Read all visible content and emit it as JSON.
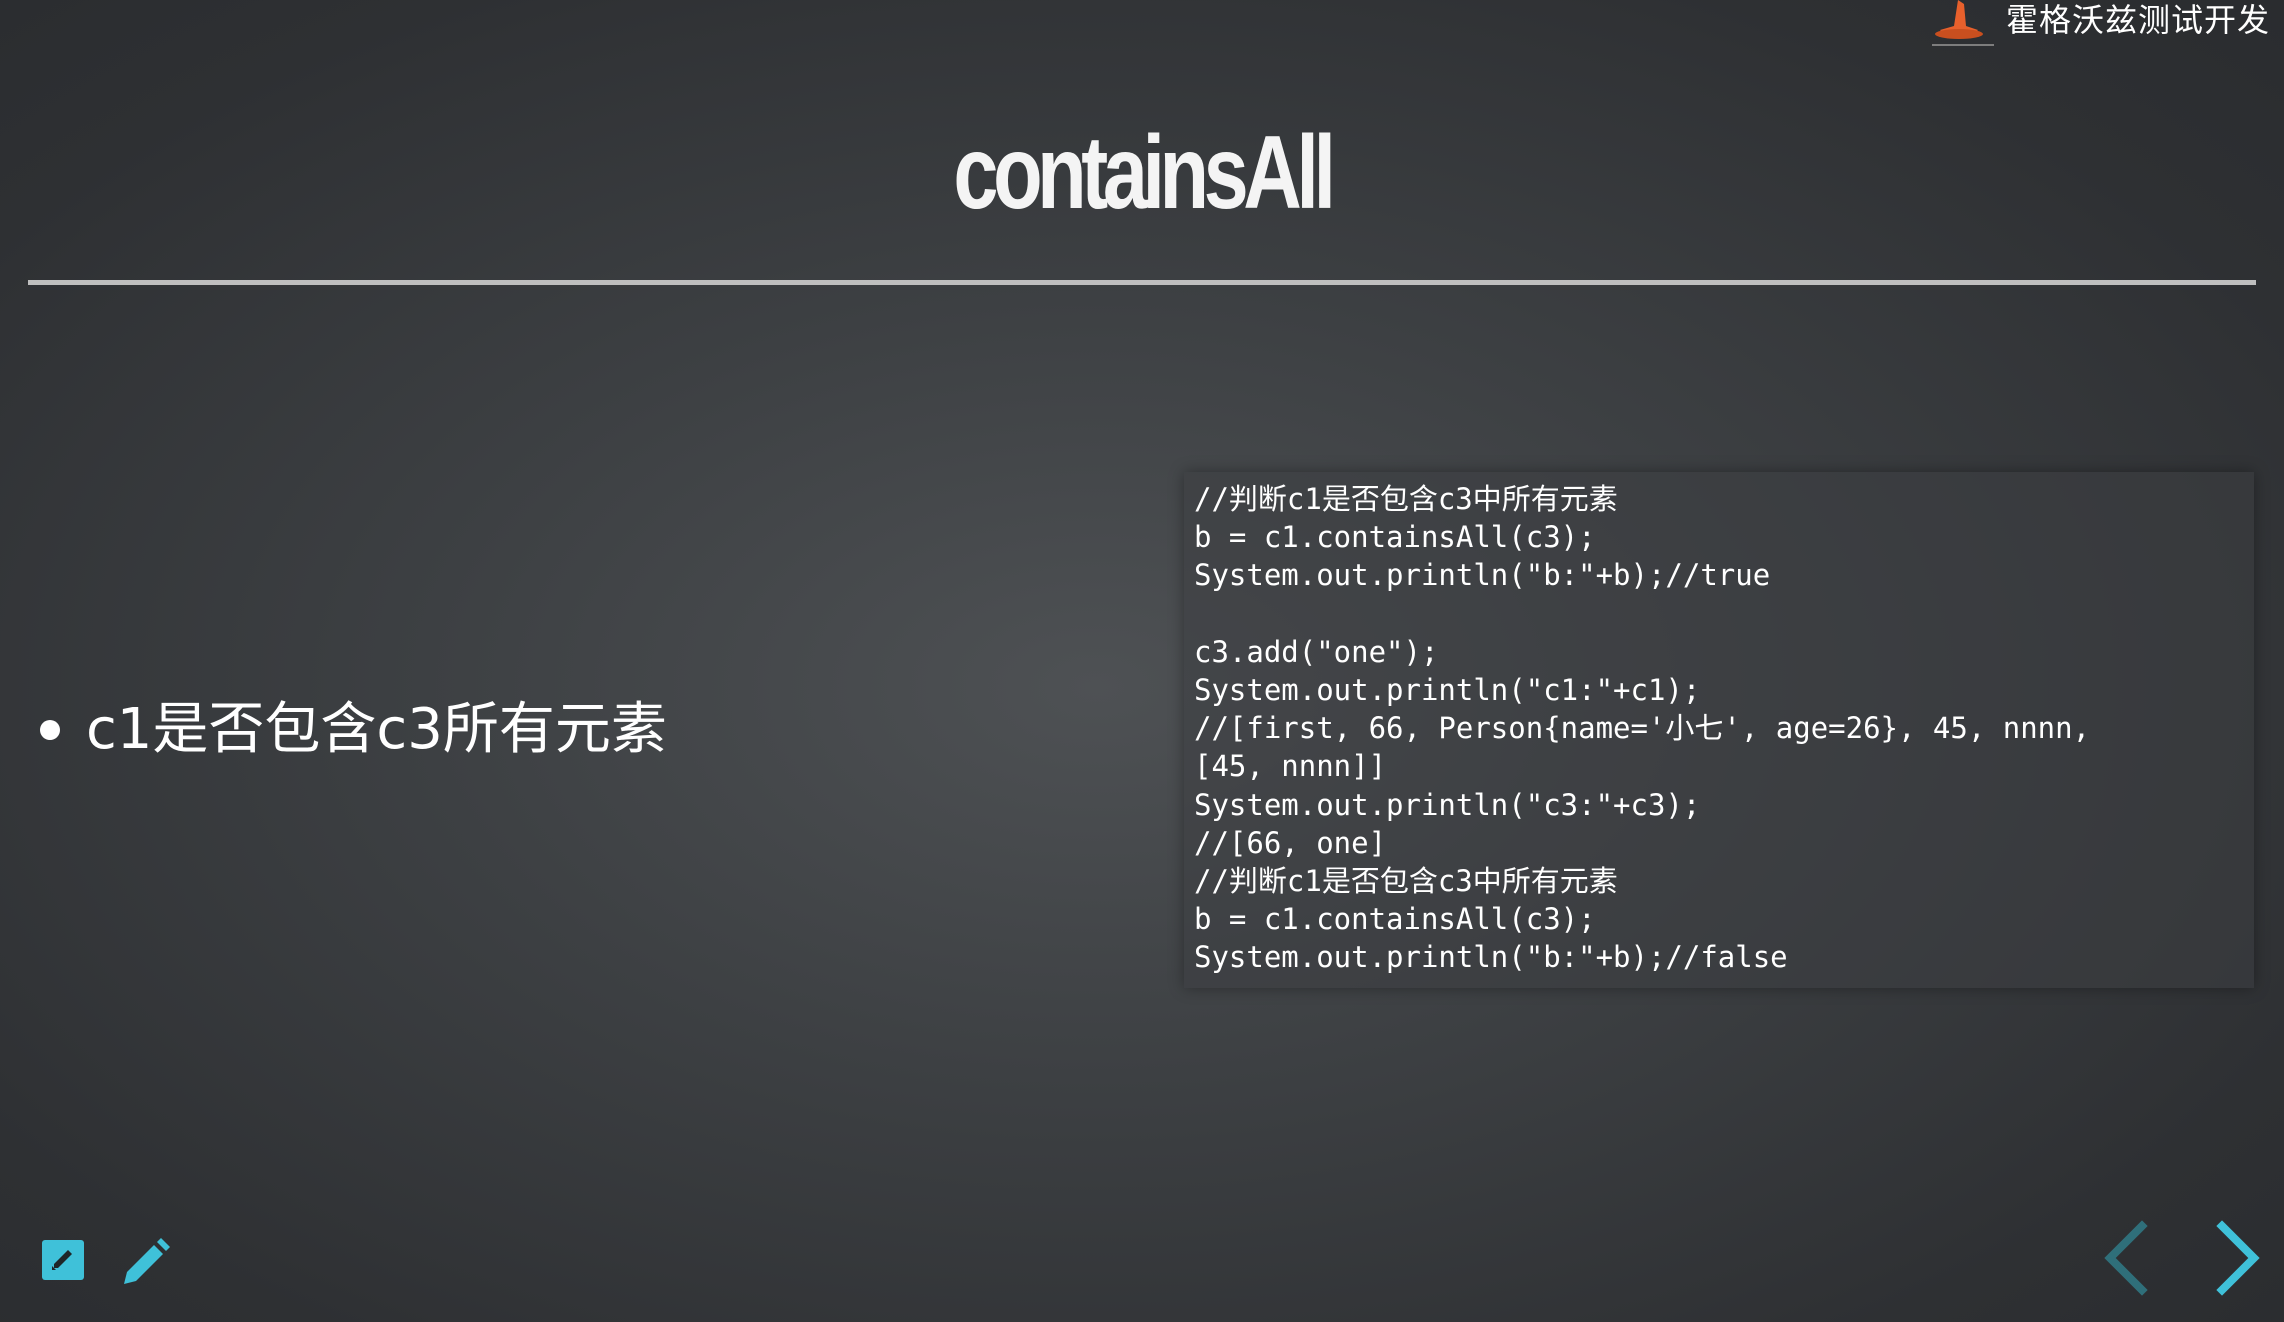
{
  "brand": {
    "name": "霍格沃兹测试开发",
    "logo_icon": "wizard-hat-icon"
  },
  "slide": {
    "title": "containsAll",
    "bullets": [
      "c1是否包含c3所有元素"
    ],
    "code_lines": [
      "//判断c1是否包含c3中所有元素",
      "b = c1.containsAll(c3);",
      "System.out.println(\"b:\"+b);//true",
      "",
      "c3.add(\"one\");",
      "System.out.println(\"c1:\"+c1);",
      "//[first, 66, Person{name='小七', age=26}, 45, nnnn,",
      "[45, nnnn]]",
      "System.out.println(\"c3:\"+c3);",
      "//[66, one]",
      "//判断c1是否包含c3中所有元素",
      "b = c1.containsAll(c3);",
      "System.out.println(\"b:\"+b);//false"
    ]
  },
  "toolbar": {
    "left_icons": [
      "edit-note-icon",
      "pencil-icon"
    ],
    "nav_icons": [
      "chevron-left-icon",
      "chevron-right-icon"
    ]
  },
  "colors": {
    "accent": "#3fc1d9",
    "nav_disabled": "#2f6f7a",
    "text": "#ffffff"
  }
}
